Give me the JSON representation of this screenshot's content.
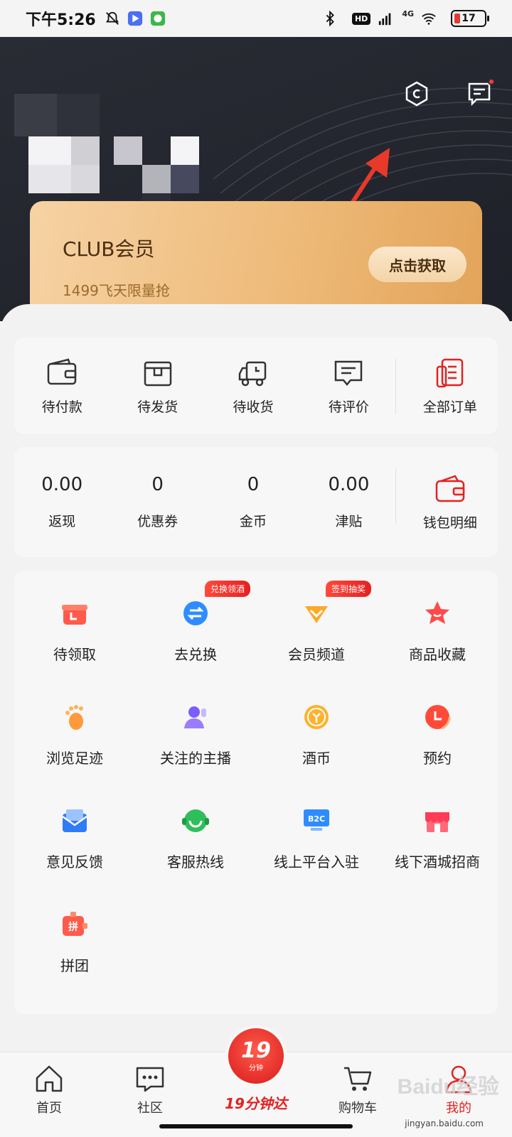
{
  "status_bar": {
    "time": "下午5:26",
    "hd": "HD",
    "network": "4G",
    "battery": "17"
  },
  "club": {
    "title": "CLUB会员",
    "subtitle": "1499飞天限量抢",
    "button": "点击获取"
  },
  "orders": [
    {
      "label": "待付款",
      "icon": "wallet-icon"
    },
    {
      "label": "待发货",
      "icon": "box-icon"
    },
    {
      "label": "待收货",
      "icon": "truck-icon"
    },
    {
      "label": "待评价",
      "icon": "comment-icon"
    },
    {
      "label": "全部订单",
      "icon": "order-list-icon"
    }
  ],
  "wallet": [
    {
      "value": "0.00",
      "label": "返现"
    },
    {
      "value": "0",
      "label": "优惠券"
    },
    {
      "value": "0",
      "label": "金币"
    },
    {
      "value": "0.00",
      "label": "津贴"
    },
    {
      "label": "钱包明细",
      "icon": "wallet-detail-icon"
    }
  ],
  "tools": [
    {
      "label": "待领取",
      "icon": "gift-box-icon"
    },
    {
      "label": "去兑换",
      "icon": "exchange-icon",
      "badge": "兑换领酒"
    },
    {
      "label": "会员频道",
      "icon": "vip-diamond-icon",
      "badge": "签到抽奖"
    },
    {
      "label": "商品收藏",
      "icon": "star-icon"
    },
    {
      "label": "浏览足迹",
      "icon": "footprint-icon"
    },
    {
      "label": "关注的主播",
      "icon": "streamer-icon"
    },
    {
      "label": "酒币",
      "icon": "coin-icon"
    },
    {
      "label": "预约",
      "icon": "clock-icon"
    },
    {
      "label": "意见反馈",
      "icon": "mail-icon"
    },
    {
      "label": "客服热线",
      "icon": "headset-icon"
    },
    {
      "label": "线上平台入驻",
      "icon": "b2c-monitor-icon"
    },
    {
      "label": "线下酒城招商",
      "icon": "store-icon"
    },
    {
      "label": "拼团",
      "icon": "group-buy-icon"
    }
  ],
  "nav": {
    "home": "首页",
    "community": "社区",
    "center_number": "19",
    "center_small": "分钟",
    "center_label": "19分钟达",
    "cart": "购物车",
    "mine": "我的"
  },
  "watermark": {
    "main": "Baidu经验",
    "sub": "jingyan.baidu.com"
  },
  "colors": {
    "accent": "#e42121",
    "header_bg": "#2a2c35",
    "card_gold": "#eebb7a"
  }
}
